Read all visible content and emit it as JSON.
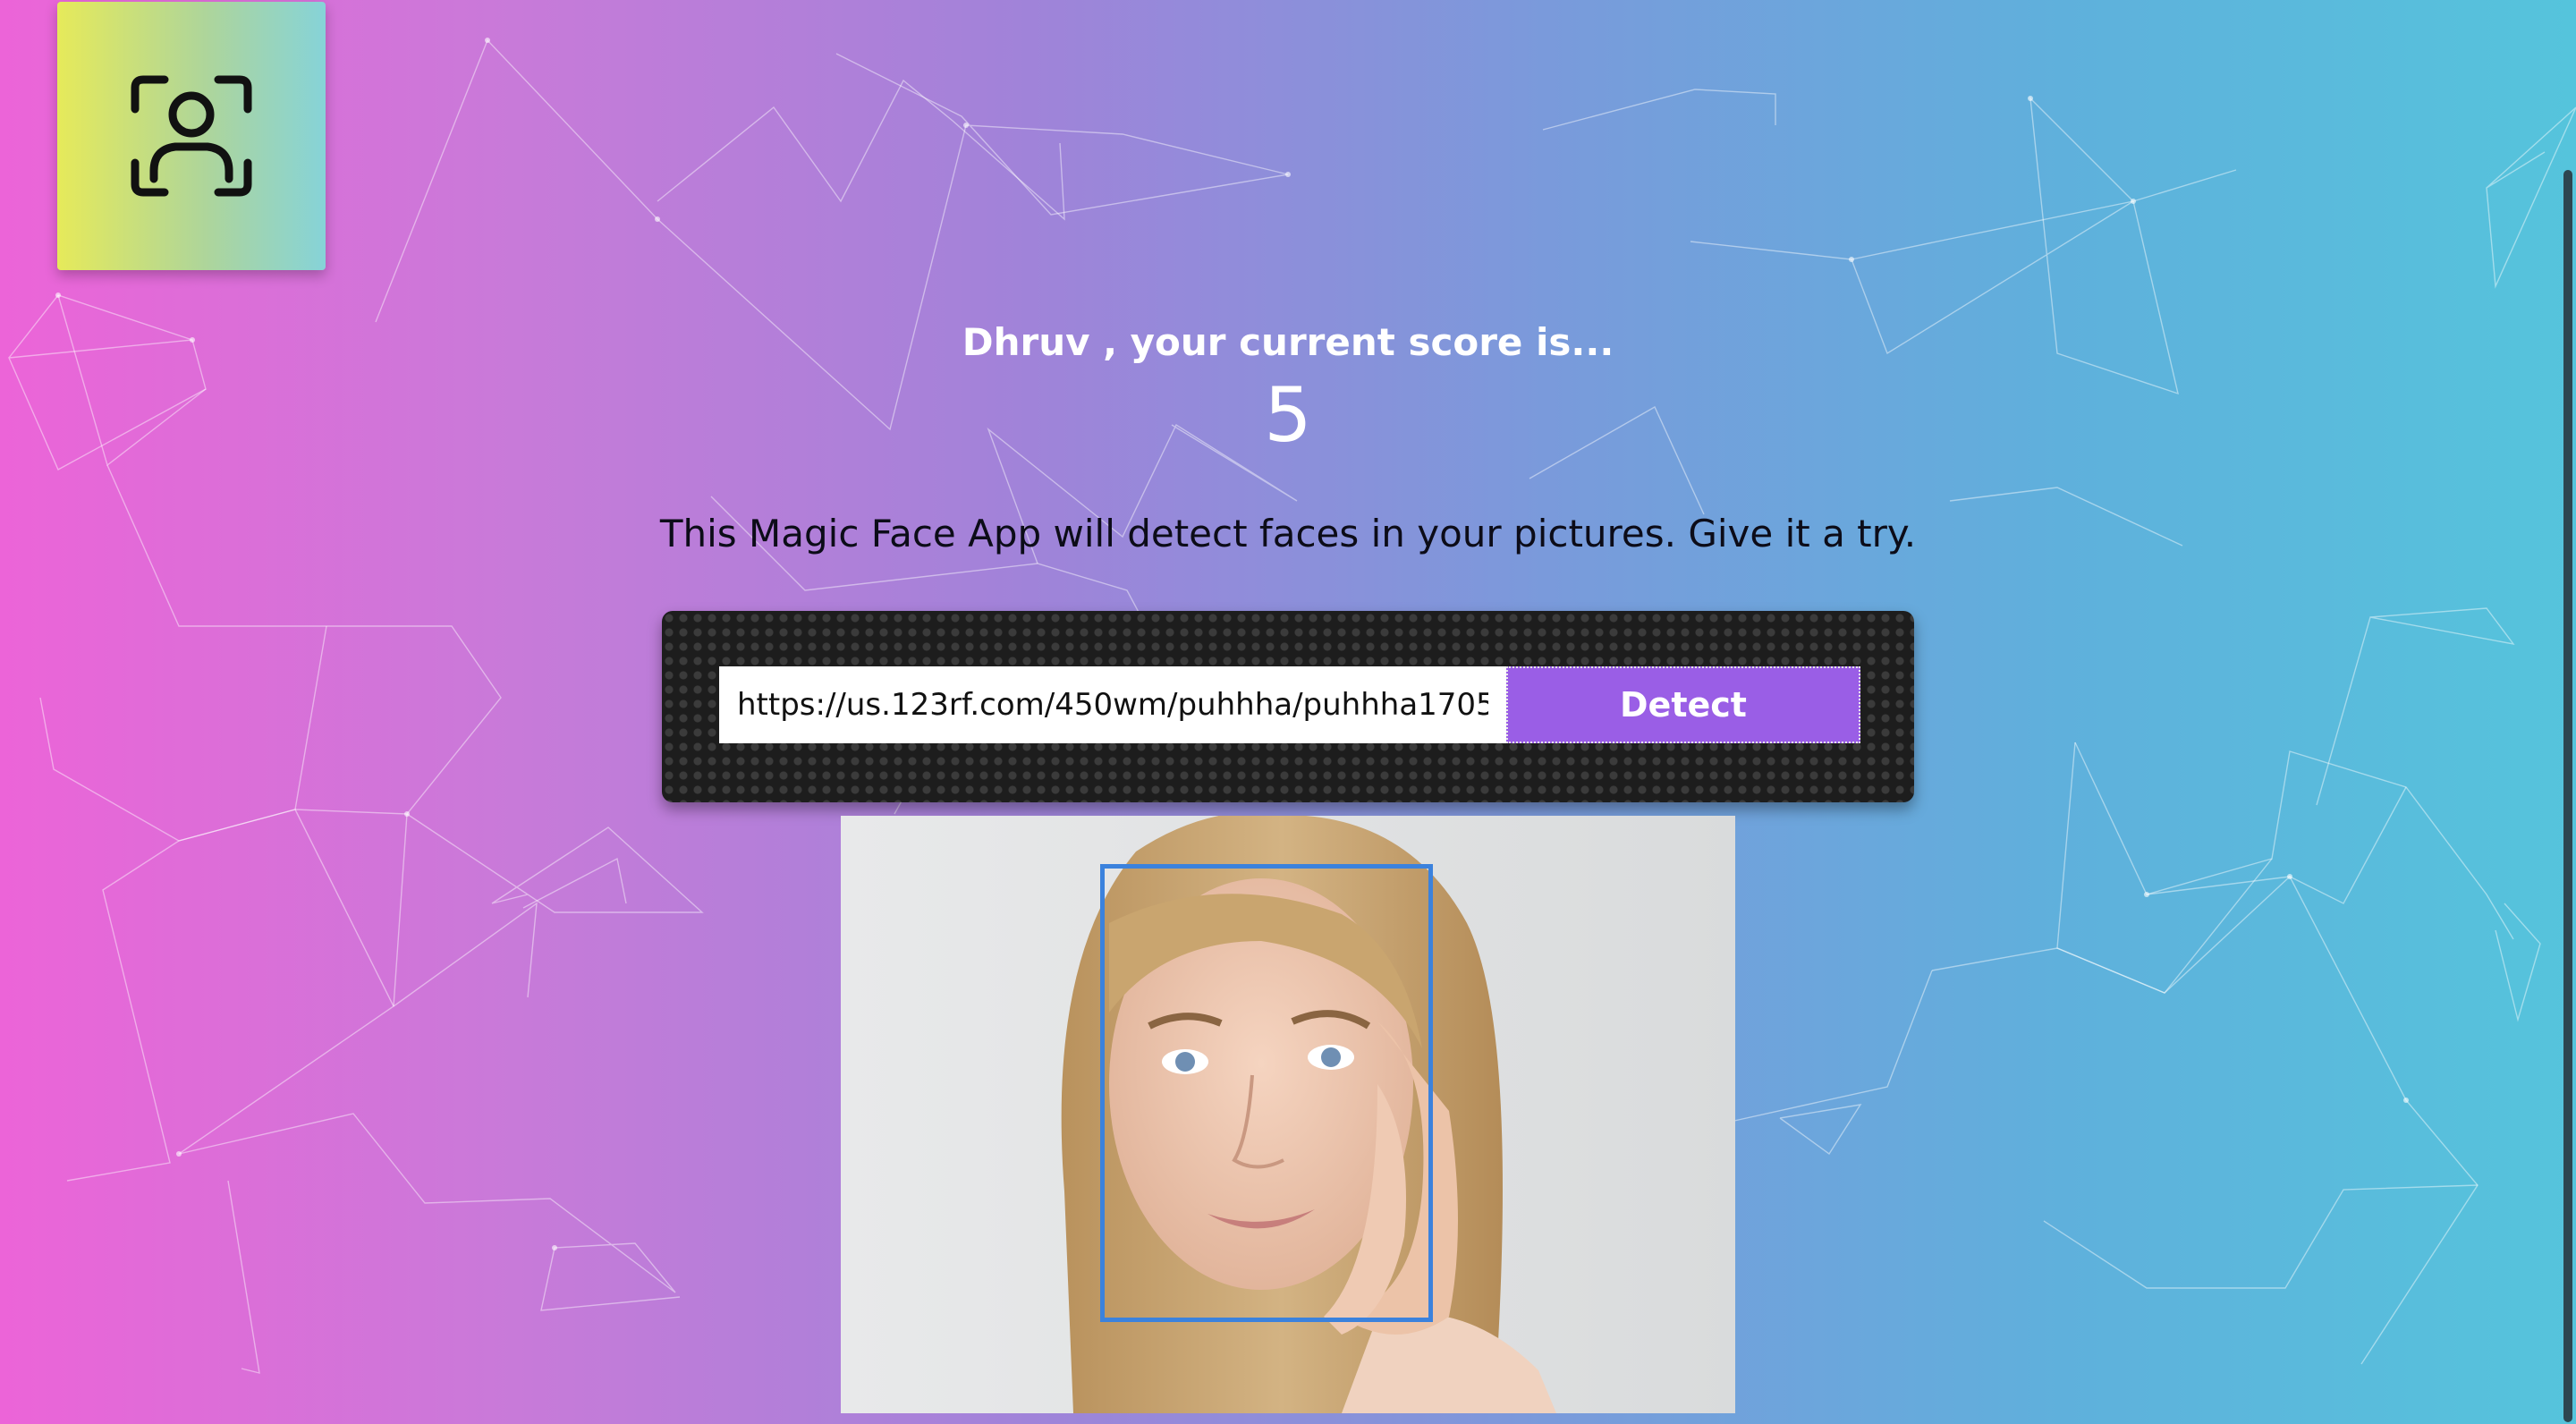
{
  "header": {
    "logo_icon": "face-recognition-icon"
  },
  "score": {
    "message": "Dhruv , your current score is...",
    "value": "5"
  },
  "intro": {
    "text": "This Magic Face App will detect faces in your pictures. Give it a try."
  },
  "form": {
    "url_value": "https://us.123rf.com/450wm/puhhha/puhhha1705/",
    "detect_label": "Detect"
  },
  "colors": {
    "button": "#9a5ee6",
    "face_box": "#3b82dd"
  }
}
